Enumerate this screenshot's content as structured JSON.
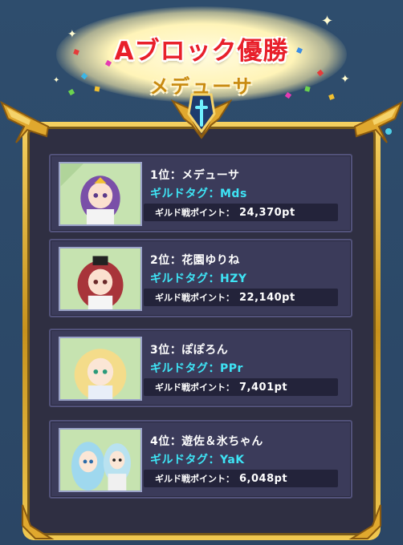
{
  "banner": {
    "title": "Aブロック優勝",
    "winner": "メデューサ"
  },
  "colors": {
    "background": "#2c4866",
    "card": "#3b3b5a",
    "gold": "#e0a82e",
    "title_red": "#e8202b",
    "tag_cyan": "#3ee4f5"
  },
  "rankings": [
    {
      "rank_label": "1位：メデューサ",
      "tag_label": "ギルドタグ：Mds",
      "points_label": "ギルド戦ポイント：",
      "points_value": "24,370pt",
      "avatar": "character-portrait-purple-hair"
    },
    {
      "rank_label": "2位：花園ゆりね",
      "tag_label": "ギルドタグ：HZY",
      "points_label": "ギルド戦ポイント：",
      "points_value": "22,140pt",
      "avatar": "character-portrait-red-hair"
    },
    {
      "rank_label": "3位：ぽぽろん",
      "tag_label": "ギルドタグ：PPr",
      "points_label": "ギルド戦ポイント：",
      "points_value": "7,401pt",
      "avatar": "character-portrait-blonde-hair"
    },
    {
      "rank_label": "4位：遊佐＆氷ちゃん",
      "tag_label": "ギルドタグ：YaK",
      "points_label": "ギルド戦ポイント：",
      "points_value": "6,048pt",
      "avatar": "character-portrait-blue-hair-duo"
    }
  ]
}
